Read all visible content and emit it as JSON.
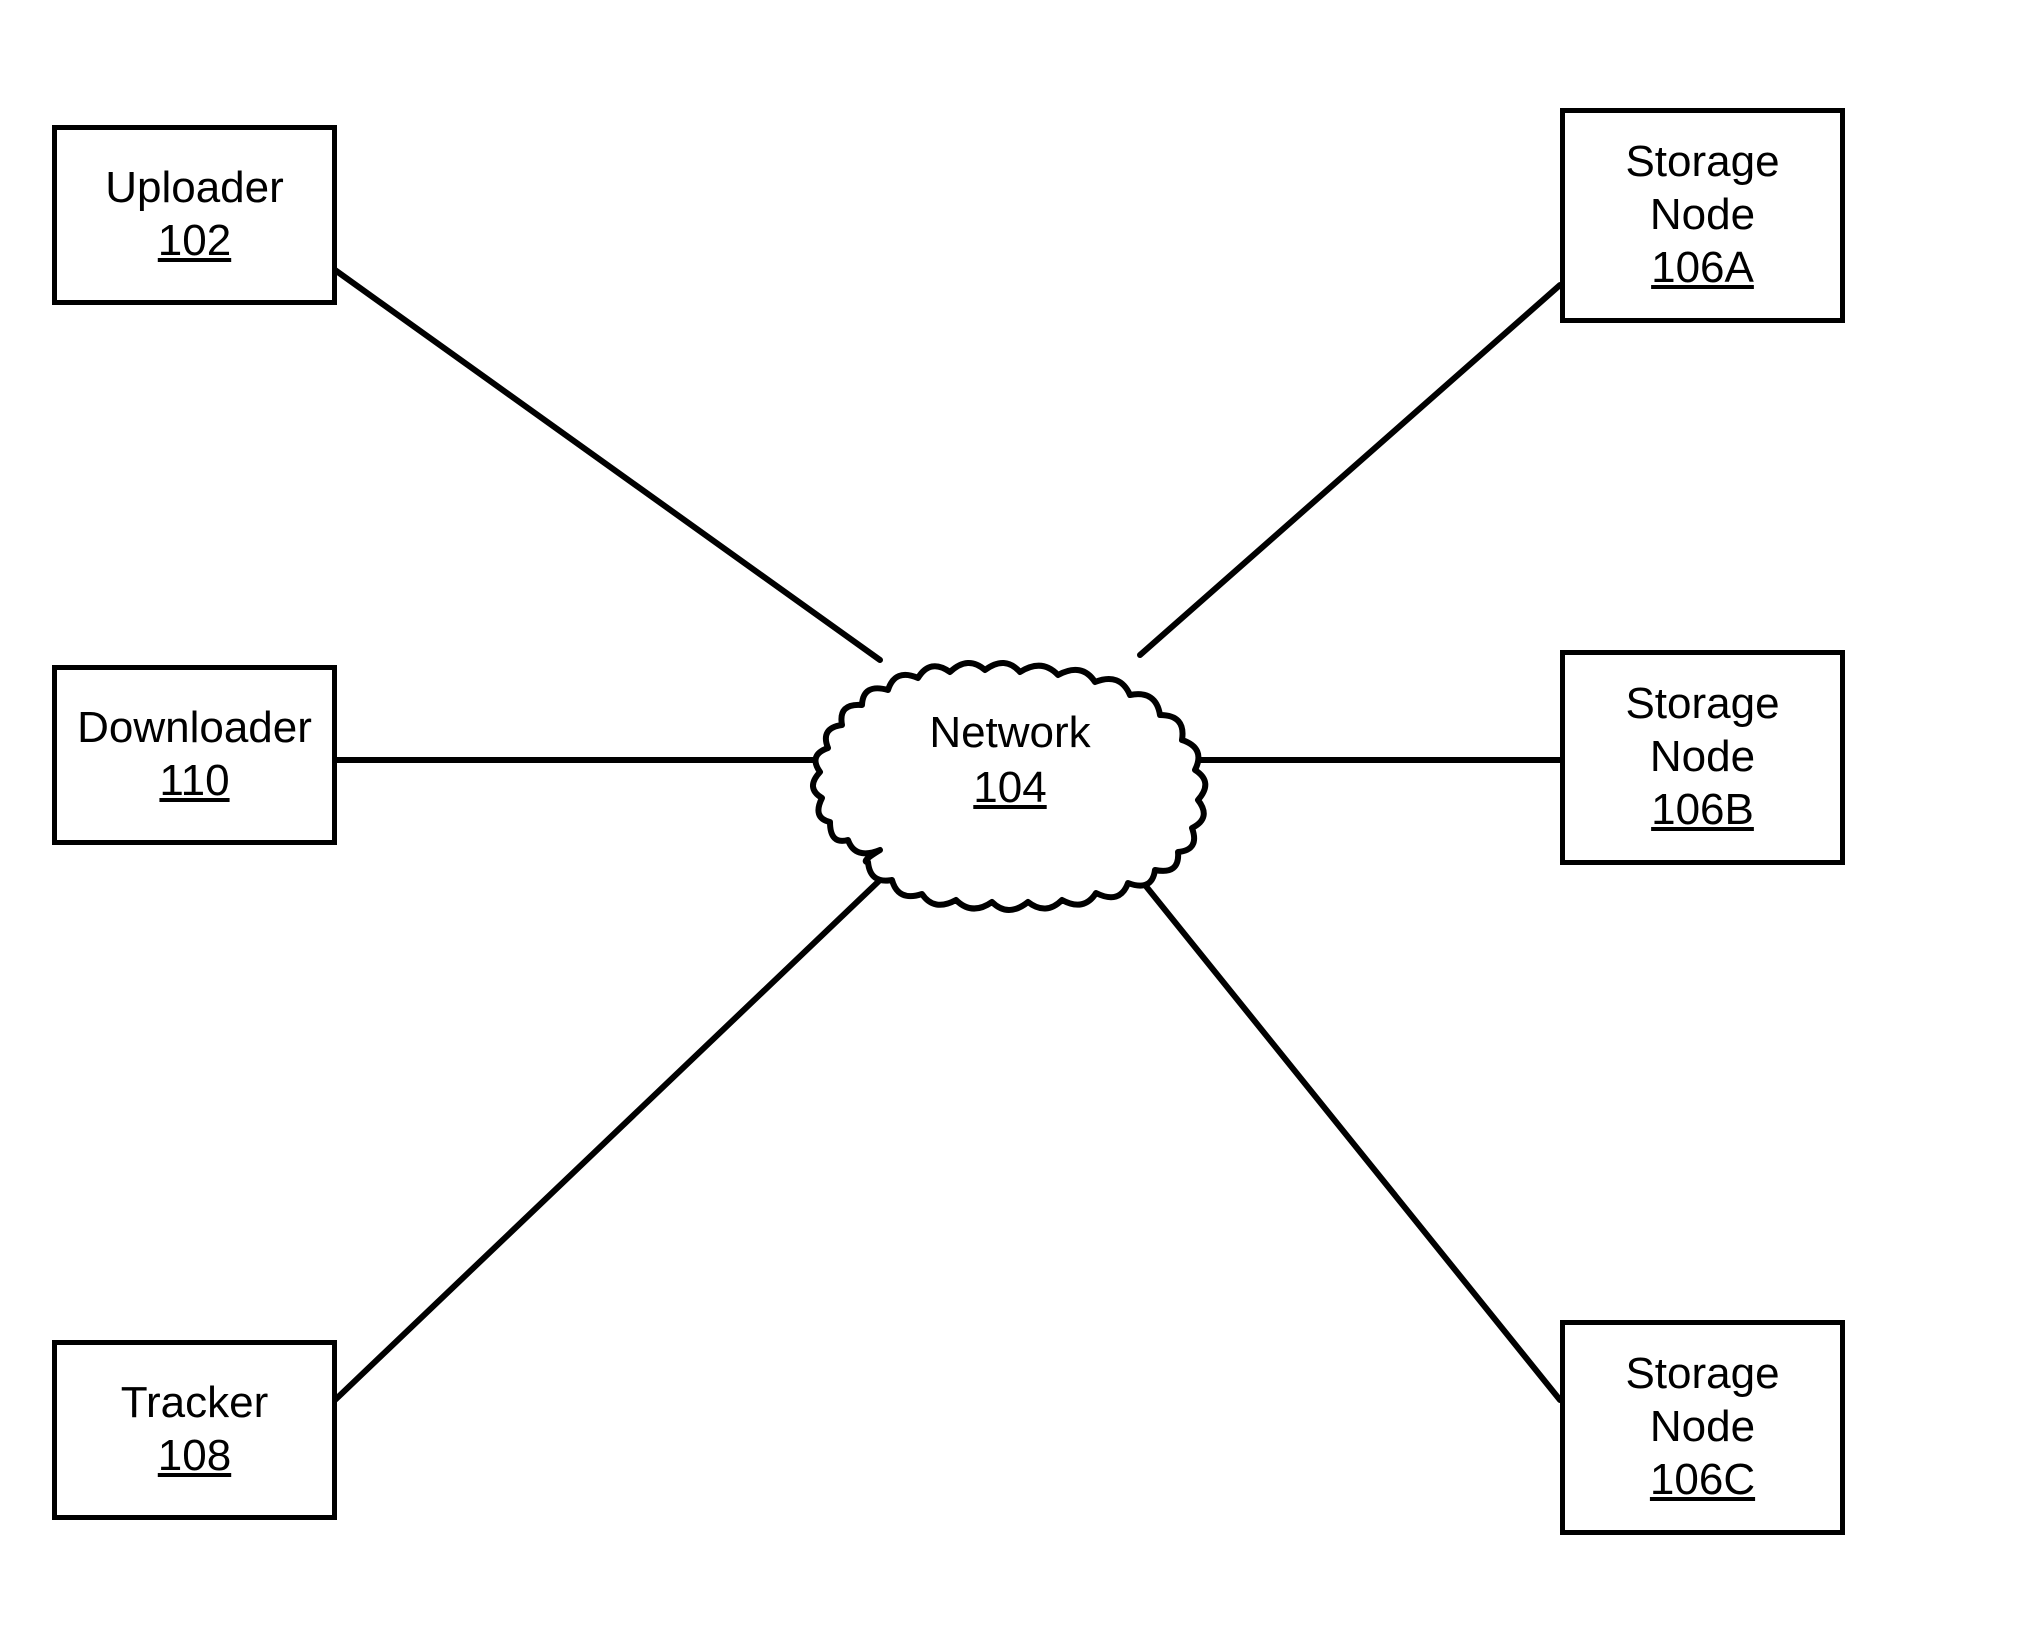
{
  "nodes": {
    "uploader": {
      "label": "Uploader",
      "ref": "102"
    },
    "downloader": {
      "label": "Downloader",
      "ref": "110"
    },
    "tracker": {
      "label": "Tracker",
      "ref": "108"
    },
    "network": {
      "label": "Network",
      "ref": "104"
    },
    "storageA": {
      "label1": "Storage",
      "label2": "Node",
      "ref": "106A"
    },
    "storageB": {
      "label1": "Storage",
      "label2": "Node",
      "ref": "106B"
    },
    "storageC": {
      "label1": "Storage",
      "label2": "Node",
      "ref": "106C"
    }
  }
}
